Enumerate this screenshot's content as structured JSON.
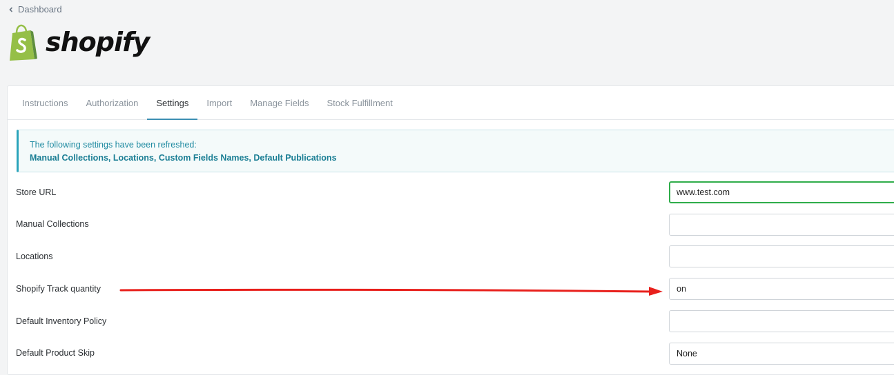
{
  "nav": {
    "back_label": "Dashboard"
  },
  "brand": {
    "wordmark": "shopify",
    "logo_icon": "shopify-bag-icon"
  },
  "tabs": [
    {
      "label": "Instructions",
      "active": false
    },
    {
      "label": "Authorization",
      "active": false
    },
    {
      "label": "Settings",
      "active": true
    },
    {
      "label": "Import",
      "active": false
    },
    {
      "label": "Manage Fields",
      "active": false
    },
    {
      "label": "Stock Fulfillment",
      "active": false
    }
  ],
  "alert": {
    "message": "The following settings have been refreshed:",
    "items": "Manual Collections, Locations, Custom Fields Names, Default Publications"
  },
  "settings": [
    {
      "label": "Store URL",
      "value": "www.test.com"
    },
    {
      "label": "Manual Collections",
      "value": ""
    },
    {
      "label": "Locations",
      "value": ""
    },
    {
      "label": "Shopify Track quantity",
      "value": "on"
    },
    {
      "label": "Default Inventory Policy",
      "value": ""
    },
    {
      "label": "Default Product Skip",
      "value": "None"
    }
  ],
  "colors": {
    "accent": "#3c8fb3",
    "alert_text": "#1e8aa1",
    "focus_border": "#2fad4a",
    "arrow": "#e8201c",
    "brand_green": "#95bf47"
  }
}
